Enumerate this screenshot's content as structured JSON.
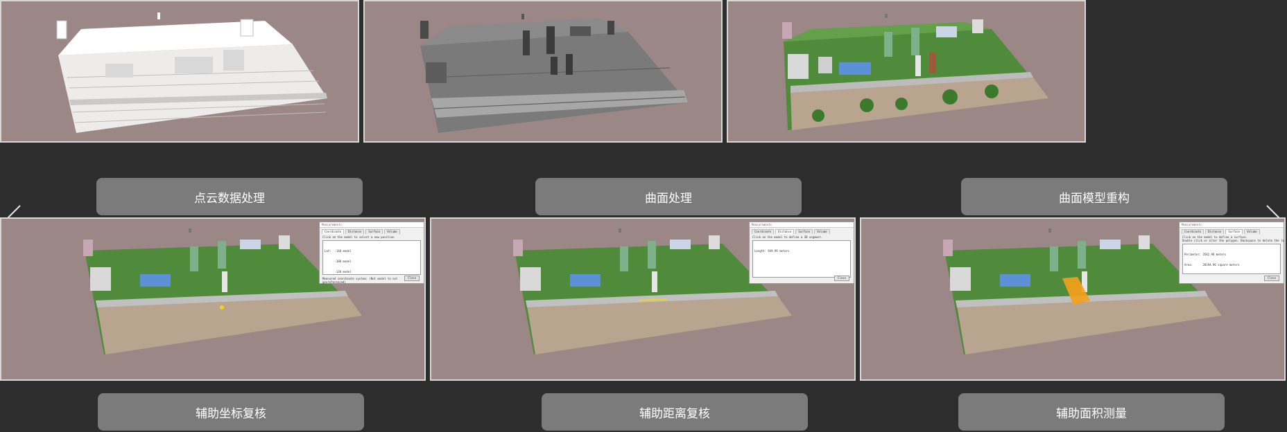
{
  "colors": {
    "background": "#2d2d2d",
    "panel": "#9b8786",
    "button": "#7b7b7b",
    "highlight": "#f5a01c"
  },
  "row1": [
    {
      "label": "点云数据处理",
      "render": "point-cloud"
    },
    {
      "label": "曲面处理",
      "render": "gray-surface"
    },
    {
      "label": "曲面模型重构",
      "render": "textured-model"
    }
  ],
  "row2": [
    {
      "label": "辅助坐标复核",
      "dialog": {
        "title": "Measurements",
        "tabs": [
          "Coordinate",
          "Distance",
          "Surface",
          "Volume"
        ],
        "active_tab": 0,
        "instruction": "Click on the model to select a new position",
        "lines": [
          "Lat:  -148 model",
          "      -188 model",
          "      -138 model"
        ],
        "footer": "Measured coordinate system:   (Not model to not georeferenced)",
        "close": "Close"
      }
    },
    {
      "label": "辅助距离复核",
      "dialog": {
        "title": "Measurements",
        "tabs": [
          "Coordinate",
          "Distance",
          "Surface",
          "Volume"
        ],
        "active_tab": 1,
        "instruction": "Click on the model to define a 3D segment.",
        "lines": [
          "Length: 949.99 meters"
        ],
        "footer": "",
        "close": "Close"
      }
    },
    {
      "label": "辅助面积测量",
      "dialog": {
        "title": "Measurements",
        "tabs": [
          "Coordinate",
          "Distance",
          "Surface",
          "Volume"
        ],
        "active_tab": 2,
        "instruction": "Click on the model to define a surface.\nDouble click or alter the polygon. Backspace to delete the last point.",
        "lines": [
          "Perimeter: 3582.98 meters",
          "Area:      28194.96 square meters"
        ],
        "footer": "",
        "close": "Close"
      }
    }
  ],
  "nav": {
    "prev_icon": "chevron-left-icon",
    "next_icon": "chevron-right-icon"
  }
}
